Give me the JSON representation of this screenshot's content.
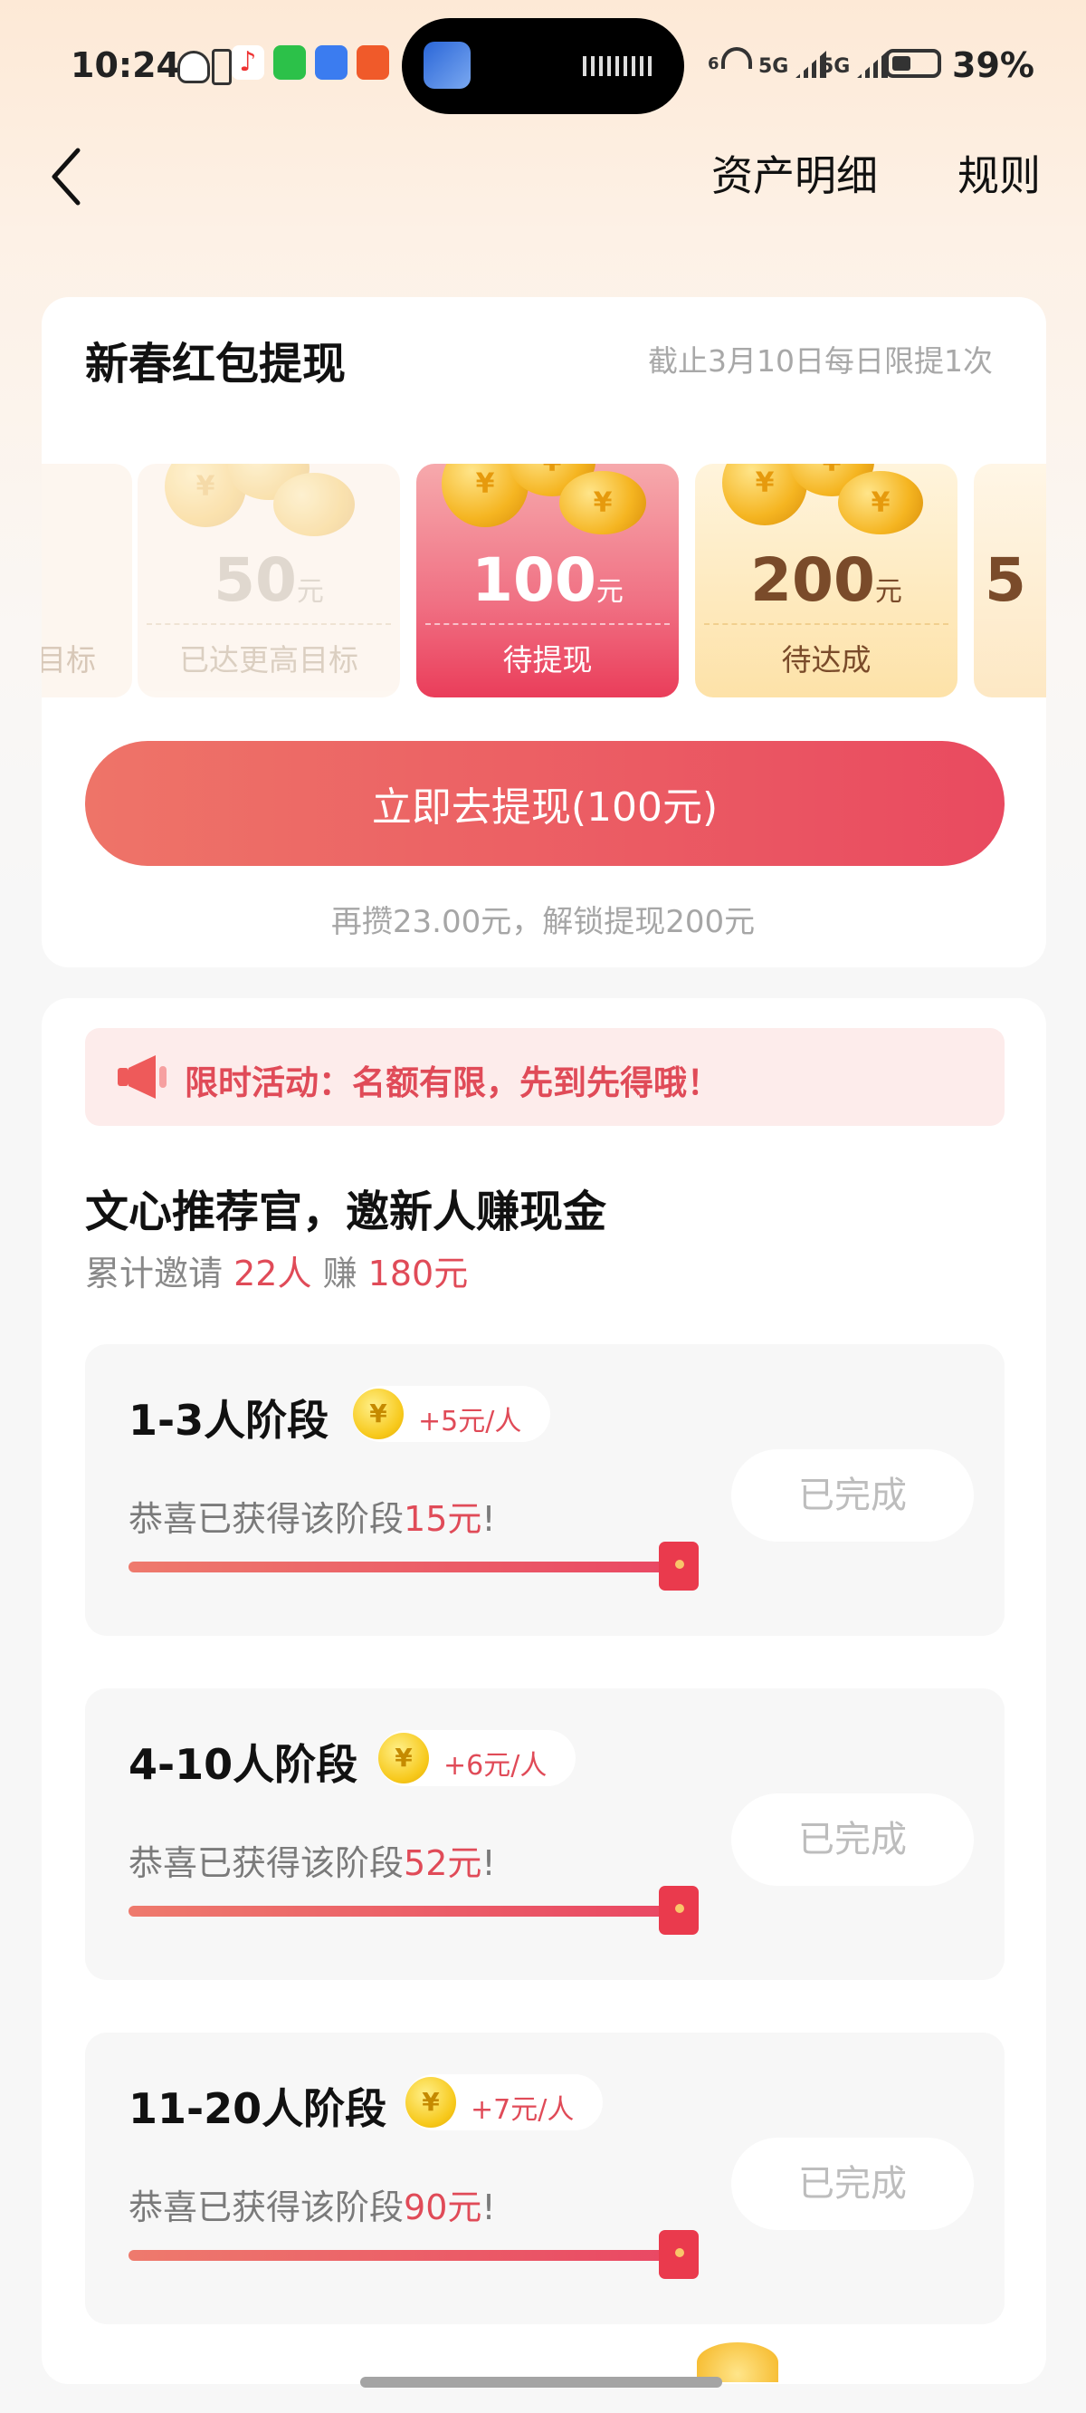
{
  "status_bar": {
    "time": "10:24",
    "signal1": "5G",
    "signal2": "5G",
    "battery": "39%",
    "wifi_label": "6"
  },
  "header": {
    "asset_detail": "资产明细",
    "rules": "规则"
  },
  "withdraw": {
    "title": "新春红包提现",
    "note": "截止3月10日每日限提1次",
    "tiles": [
      {
        "amount": "",
        "unit": "",
        "label": "目标"
      },
      {
        "amount": "50",
        "unit": "元",
        "label": "已达更高目标"
      },
      {
        "amount": "100",
        "unit": "元",
        "label": "待提现"
      },
      {
        "amount": "200",
        "unit": "元",
        "label": "待达成"
      },
      {
        "amount": "5",
        "unit": "",
        "label": ""
      }
    ],
    "button": "立即去提现(100元)",
    "unlock_tip": "再攒23.00元，解锁提现200元"
  },
  "invite": {
    "banner": "限时活动：名额有限，先到先得哦！",
    "title": "文心推荐官，邀新人赚现金",
    "summary_prefix": "累计邀请",
    "invited": "22人",
    "earn_label": "赚",
    "earned": "180元",
    "stages": [
      {
        "name": "1-3人阶段",
        "rate": "+5元/人",
        "msg_prefix": "恭喜已获得该阶段",
        "msg_amount": "15元",
        "msg_suffix": "!",
        "progress": 1.0,
        "status": "已完成"
      },
      {
        "name": "4-10人阶段",
        "rate": "+6元/人",
        "msg_prefix": "恭喜已获得该阶段",
        "msg_amount": "52元",
        "msg_suffix": "!",
        "progress": 1.0,
        "status": "已完成"
      },
      {
        "name": "11-20人阶段",
        "rate": "+7元/人",
        "msg_prefix": "恭喜已获得该阶段",
        "msg_amount": "90元",
        "msg_suffix": "!",
        "progress": 1.0,
        "status": "已完成"
      }
    ]
  },
  "icons": {
    "yen": "¥",
    "back": "chevron-left-icon",
    "speaker": "megaphone-icon"
  },
  "colors": {
    "accent": "#e94a60",
    "accent_light": "#ee7468",
    "muted": "#a6a6a6"
  }
}
